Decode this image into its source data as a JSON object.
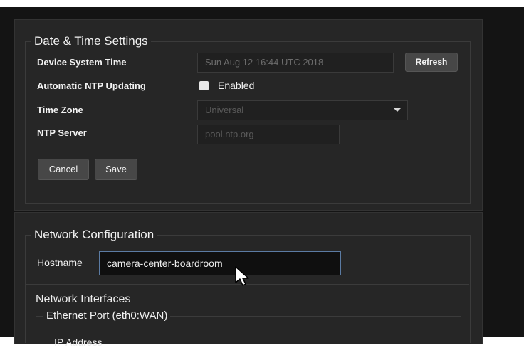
{
  "datetime": {
    "title": "Date & Time Settings",
    "device_time_label": "Device System Time",
    "device_time_value": "Sun Aug 12 16:44 UTC 2018",
    "refresh_label": "Refresh",
    "ntp_update_label": "Automatic NTP Updating",
    "ntp_enabled_label": "Enabled",
    "ntp_enabled_checked": true,
    "timezone_label": "Time Zone",
    "timezone_value": "Universal",
    "ntp_server_label": "NTP Server",
    "ntp_server_placeholder": "pool.ntp.org",
    "cancel_label": "Cancel",
    "save_label": "Save"
  },
  "network": {
    "title": "Network Configuration",
    "hostname_label": "Hostname",
    "hostname_value": "camera-center-boardroom",
    "interfaces_title": "Network Interfaces",
    "ethernet_title": "Ethernet Port (eth0:WAN)",
    "ip_address_label": "IP Address"
  },
  "colors": {
    "background": "#141414",
    "panel": "#262626",
    "focus_border": "#5b7ba3"
  }
}
